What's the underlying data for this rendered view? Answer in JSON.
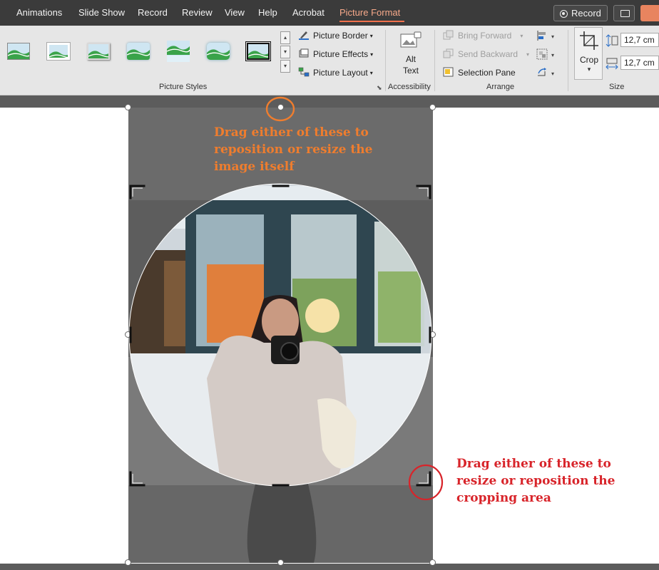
{
  "menu": {
    "items": [
      "Animations",
      "Slide Show",
      "Record",
      "Review",
      "View",
      "Help",
      "Acrobat",
      "Picture Format"
    ],
    "active": "Picture Format",
    "record_label": "Record"
  },
  "ribbon": {
    "picture_styles": {
      "label": "Picture Styles",
      "thumbnail_count": 7,
      "border_label": "Picture Border",
      "effects_label": "Picture Effects",
      "layout_label": "Picture Layout"
    },
    "accessibility": {
      "label": "Accessibility",
      "alt_text_line1": "Alt",
      "alt_text_line2": "Text"
    },
    "arrange": {
      "label": "Arrange",
      "bring_forward": "Bring Forward",
      "send_backward": "Send Backward",
      "selection_pane": "Selection Pane"
    },
    "size": {
      "label": "Size",
      "crop_label": "Crop",
      "height_value": "12,7 cm",
      "width_value": "12,7 cm"
    }
  },
  "annotations": {
    "image_note_lines": [
      "Drag either of these to",
      "reposition or resize the",
      "image itself"
    ],
    "crop_note_lines": [
      "Drag either of these to",
      "resize or reposition the",
      "cropping area"
    ],
    "image_note_color": "#ef7d2e",
    "crop_note_color": "#d8242a"
  },
  "colors": {
    "accent": "#f2714c",
    "menubar": "#3b3b3b",
    "ribbon": "#e6e6e6"
  }
}
